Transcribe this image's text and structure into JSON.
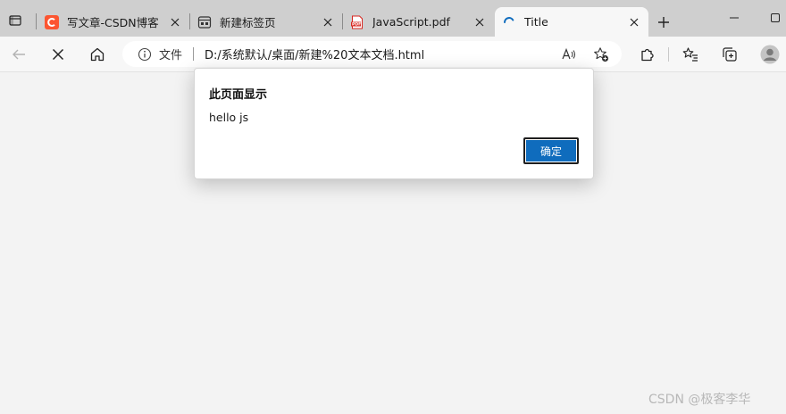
{
  "tabs": [
    {
      "title": "写文章-CSDN博客",
      "favicon": "csdn-logo-icon",
      "active": false
    },
    {
      "title": "新建标签页",
      "favicon": "new-tab-page-icon",
      "active": false
    },
    {
      "title": "JavaScript.pdf",
      "favicon": "pdf-icon",
      "active": false
    },
    {
      "title": "Title",
      "favicon": "loading-spinner-icon",
      "active": true
    }
  ],
  "address_bar": {
    "scheme_label": "文件",
    "url": "D:/系统默认/桌面/新建%20文本文档.html"
  },
  "alert_dialog": {
    "heading": "此页面显示",
    "message": "hello js",
    "ok_label": "确定"
  },
  "watermark": "CSDN @极客李华",
  "colors": {
    "accent": "#0f6cbd",
    "csdn_brand": "#fc5531",
    "pdf_red": "#d7261f",
    "page_background": "#f3f3f3",
    "tab_strip": "#cfcfcf"
  }
}
